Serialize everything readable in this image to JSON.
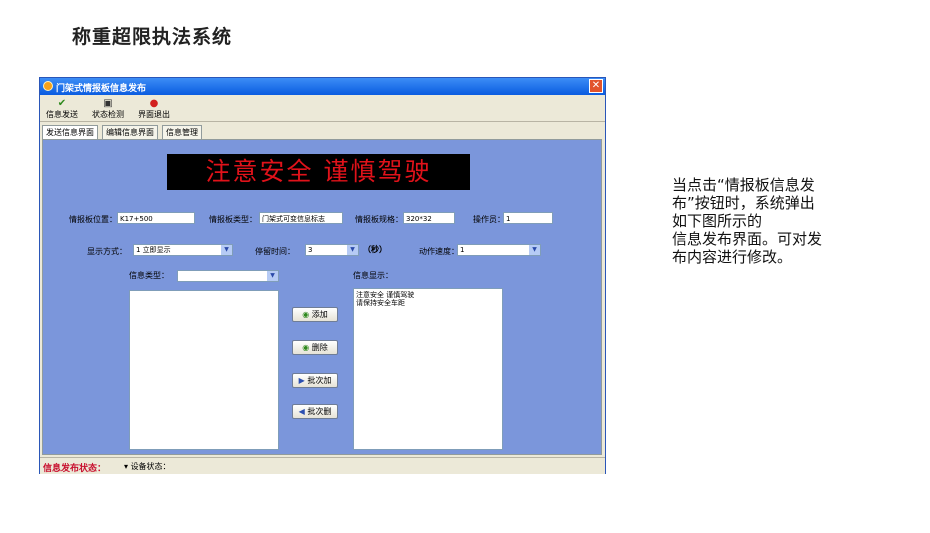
{
  "slide": {
    "title": "称重超限执法系统",
    "caption_lines": [
      "当点击“情报板信息发",
      "布”按钮时，系统弹出",
      "如下图所示的",
      "信息发布界面。可对发",
      "布内容进行修改。"
    ]
  },
  "window": {
    "title": "门架式情报板信息发布",
    "close_icon": "close-icon"
  },
  "toolbar": {
    "send_label": "信息发送",
    "check_label": "状态检测",
    "exit_label": "界面退出"
  },
  "tabs": [
    "发送信息界面",
    "编辑信息界面",
    "信息管理"
  ],
  "led": {
    "text": "注意安全  谨慎驾驶",
    "color": "#e0121a"
  },
  "form": {
    "position_label": "情报板位置：",
    "position_value": "K17+500",
    "type_label": "情报板类型：",
    "type_value": "门架式可变信息标志",
    "spec_label": "情报板规格：",
    "spec_value": "320*32",
    "operator_label": "操作员：",
    "operator_value": "1",
    "display_mode_label": "显示方式：",
    "display_mode_value": "1  立即显示",
    "stay_time_label": "停留时间：",
    "stay_time_value": "3",
    "stay_time_unit": "（秒）",
    "speed_label": "动作速度：",
    "speed_value": "1",
    "info_type_label": "信息类型：",
    "info_type_value": "",
    "info_display_label": "信息显示：",
    "info_display_lines": [
      "注意安全  谨慎驾驶",
      "请保持安全车距"
    ]
  },
  "actions": {
    "add": "添加",
    "delete": "删除",
    "batch_add": "批次加",
    "batch_delete": "批次删"
  },
  "status": {
    "publish_label": "信息发布状态：",
    "device_label": "设备状态："
  },
  "colors": {
    "panel_bg": "#7b96db",
    "titlebar": "#0a5ce0",
    "status_red": "#c8102e"
  }
}
